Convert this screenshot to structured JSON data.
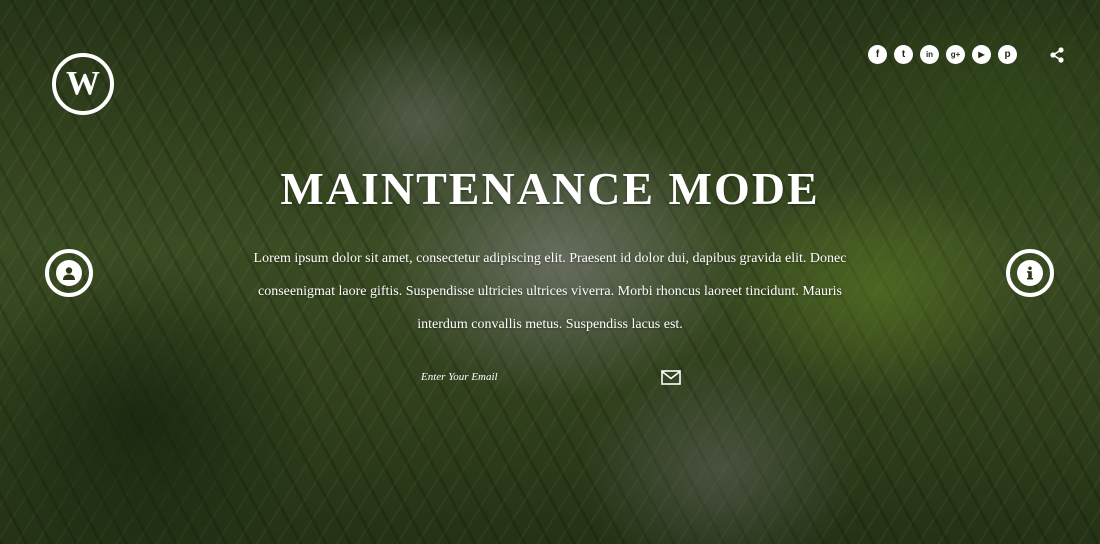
{
  "logo": {
    "letter": "W"
  },
  "social": {
    "items": [
      {
        "icon": "facebook-icon",
        "glyph": "f"
      },
      {
        "icon": "twitter-icon",
        "glyph": "t"
      },
      {
        "icon": "linkedin-icon",
        "glyph": "in"
      },
      {
        "icon": "google-plus-icon",
        "glyph": "g+"
      },
      {
        "icon": "youtube-icon",
        "glyph": "▶"
      },
      {
        "icon": "pinterest-icon",
        "glyph": "p"
      }
    ],
    "share_icon": "share-icon"
  },
  "side_buttons": {
    "left_icon": "user-icon",
    "right_icon": "info-icon"
  },
  "hero": {
    "title": "MAINTENANCE MODE",
    "description": "Lorem ipsum dolor sit amet, consectetur adipiscing elit. Praesent id dolor dui, dapibus gravida elit. Donec conseenigmat laore giftis. Suspendisse ultricies ultrices viverra. Morbi rhoncus laoreet tincidunt. Mauris interdum convallis metus. Suspendiss lacus est."
  },
  "subscribe": {
    "placeholder": "Enter Your Email",
    "submit_icon": "envelope-icon"
  },
  "colors": {
    "text": "#ffffff",
    "foliage_dark": "#2d3d1b",
    "foliage_mid": "#475c2a"
  }
}
